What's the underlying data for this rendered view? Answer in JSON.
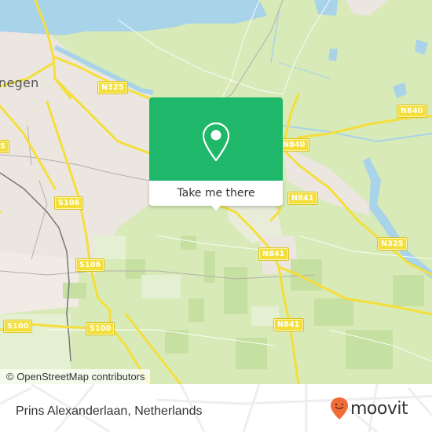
{
  "map": {
    "city_label": "negen",
    "road_shields": [
      {
        "id": "n325-top",
        "label": "N325"
      },
      {
        "id": "n840-right",
        "label": "N840"
      },
      {
        "id": "n840-center",
        "label": "N840"
      },
      {
        "id": "n841-center",
        "label": "N841"
      },
      {
        "id": "n841-lower",
        "label": "N841"
      },
      {
        "id": "n841-bottom",
        "label": "N841"
      },
      {
        "id": "n325-right",
        "label": "N325"
      },
      {
        "id": "s106-top",
        "label": "S106"
      },
      {
        "id": "s106-bottom",
        "label": "S106"
      },
      {
        "id": "s100-left",
        "label": "S100"
      },
      {
        "id": "s100-right",
        "label": "S100"
      },
      {
        "id": "s-edge",
        "label": "S"
      }
    ],
    "attribution": "© OpenStreetMap contributors",
    "colors": {
      "land": "#d7eab8",
      "urban": "#ece6e1",
      "water": "#a9d3e9",
      "road": "#f4df3a",
      "popup": "#1fb86b"
    }
  },
  "popup": {
    "button_label": "Take me there",
    "icon": "location-pin-icon"
  },
  "footer": {
    "place_name": "Prins Alexanderlaan, Netherlands",
    "brand": "moovit",
    "brand_color": "#f26a36"
  }
}
